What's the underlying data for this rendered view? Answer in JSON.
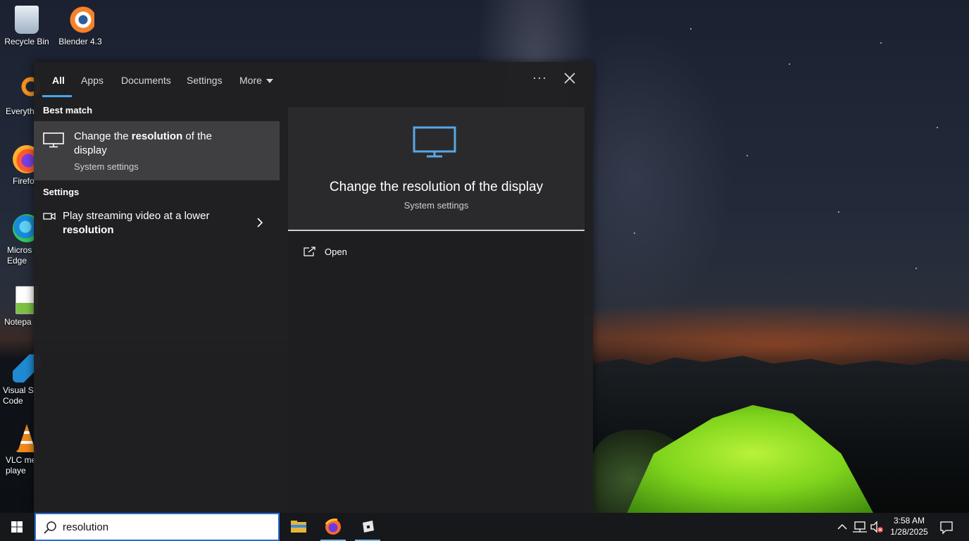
{
  "desktop": {
    "icons": [
      {
        "label": "Recycle Bin",
        "icon": "recycle-bin-icon"
      },
      {
        "label": "Blender 4.3",
        "icon": "blender-icon"
      },
      {
        "label": "Everyth",
        "icon": "everything-icon"
      },
      {
        "label": "Firefo",
        "icon": "firefox-icon"
      },
      {
        "label": "Micros\nEdge",
        "icon": "edge-icon"
      },
      {
        "label": "Notepa",
        "icon": "notepad-icon"
      },
      {
        "label": "Visual St\nCode",
        "icon": "vscode-icon"
      },
      {
        "label": "VLC me\nplaye",
        "icon": "vlc-icon"
      }
    ]
  },
  "search": {
    "tabs": [
      {
        "label": "All",
        "active": true
      },
      {
        "label": "Apps"
      },
      {
        "label": "Documents"
      },
      {
        "label": "Settings"
      },
      {
        "label": "More"
      }
    ],
    "ellipsis": "···",
    "best_match_heading": "Best match",
    "best_match": {
      "title_pre": "Change the ",
      "title_bold": "resolution",
      "title_post": " of the display",
      "subtitle": "System settings",
      "icon": "monitor-icon"
    },
    "settings_heading": "Settings",
    "settings_result": {
      "text_pre": "Play streaming video at a lower ",
      "text_bold": "resolution",
      "icon": "video-icon"
    },
    "preview": {
      "title": "Change the resolution of the display",
      "subtitle": "System settings",
      "open_label": "Open"
    },
    "query": "resolution"
  },
  "taskbar": {
    "apps": [
      "file-explorer-icon",
      "firefox-icon",
      "roblox-icon"
    ],
    "clock_time": "3:58 AM",
    "clock_date": "1/28/2025"
  },
  "colors": {
    "accent": "#4aa3f0",
    "panel": "#202022",
    "selected": "#3f3f42",
    "monitor_icon": "#5ba6e4"
  }
}
